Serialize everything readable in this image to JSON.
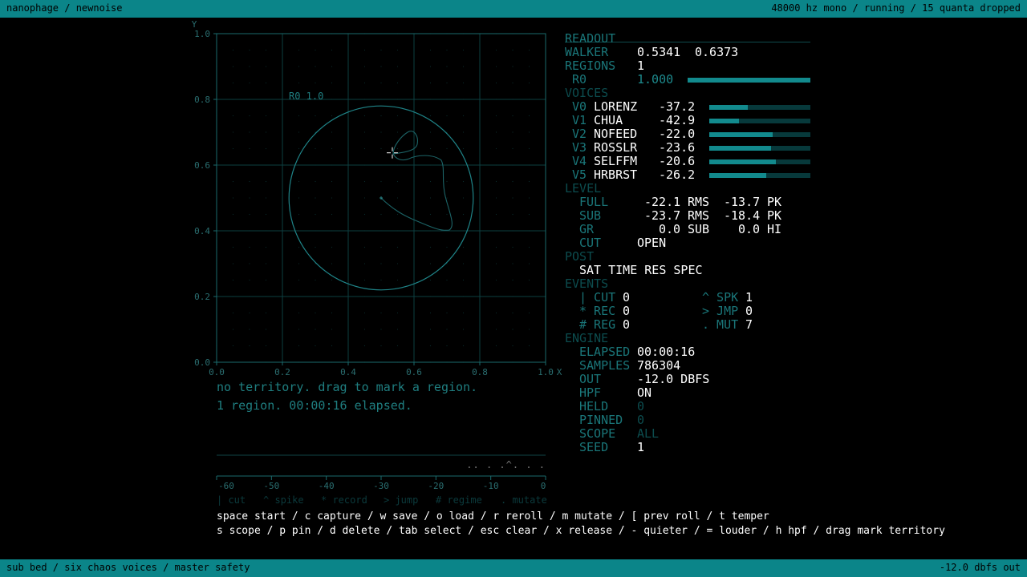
{
  "topbar": {
    "left": "nanophage / newnoise",
    "right": "48000 hz mono / running / 15 quanta dropped"
  },
  "bottombar": {
    "left": "sub bed / six chaos voices / master safety",
    "right": "-12.0 dbfs out"
  },
  "plot": {
    "x_ticks": [
      "0.0",
      "0.2",
      "0.4",
      "0.6",
      "0.8",
      "1.0"
    ],
    "y_ticks": [
      "0.0",
      "0.2",
      "0.4",
      "0.6",
      "0.8",
      "1.0"
    ],
    "x_label": "X",
    "y_label": "Y",
    "region_label": "R0 1.0",
    "region": {
      "cx": 0.5,
      "cy": 0.5,
      "r": 0.28
    },
    "walker": {
      "x": 0.5341,
      "y": 0.6373
    },
    "seed_point": {
      "x": 0.5,
      "y": 0.5
    }
  },
  "status": {
    "line1": "no territory. drag to mark a region.",
    "line2": "1 region. 00:00:16 elapsed."
  },
  "scope": {
    "event_marks": ".. .   .^. . .",
    "ticks": [
      "-60",
      "-50",
      "-40",
      "-30",
      "-20",
      "-10",
      "0"
    ],
    "legend": [
      "| cut",
      "^ spike",
      "* record",
      "> jump",
      "# regime",
      ". mutate"
    ]
  },
  "readout": {
    "title": "READOUT",
    "walker_label": "WALKER",
    "walker_x": "0.5341",
    "walker_y": "0.6373",
    "regions_label": "REGIONS",
    "regions_value": "1",
    "r0_label": "R0",
    "r0_value": "1.000",
    "r0_level": 1.0,
    "voices_label": "VOICES",
    "voices": [
      {
        "id": "V0",
        "name": "LORENZ",
        "db": "-37.2",
        "level": 0.38
      },
      {
        "id": "V1",
        "name": "CHUA",
        "db": "-42.9",
        "level": 0.29
      },
      {
        "id": "V2",
        "name": "NOFEED",
        "db": "-22.0",
        "level": 0.63
      },
      {
        "id": "V3",
        "name": "ROSSLR",
        "db": "-23.6",
        "level": 0.61
      },
      {
        "id": "V4",
        "name": "SELFFM",
        "db": "-20.6",
        "level": 0.66
      },
      {
        "id": "V5",
        "name": "HRBRST",
        "db": "-26.2",
        "level": 0.56
      }
    ],
    "level_label": "LEVEL",
    "full_label": "FULL",
    "full_rms": "-22.1",
    "full_pk": "-13.7",
    "sub_label": "SUB",
    "sub_rms": "-23.7",
    "sub_pk": "-18.4",
    "rms_unit": "RMS",
    "pk_unit": "PK",
    "gr_label": "GR",
    "gr_sub": "0.0",
    "gr_sub_unit": "SUB",
    "gr_hi": "0.0",
    "gr_hi_unit": "HI",
    "cut_label": "CUT",
    "cut_value": "OPEN",
    "post_label": "POST",
    "post_value": "SAT TIME RES SPEC",
    "events_label": "EVENTS",
    "events": [
      {
        "label": "| CUT",
        "value": "0",
        "label2": "^ SPK",
        "value2": "1"
      },
      {
        "label": "* REC",
        "value": "0",
        "label2": "> JMP",
        "value2": "0"
      },
      {
        "label": "# REG",
        "value": "0",
        "label2": ". MUT",
        "value2": "7"
      }
    ],
    "engine_label": "ENGINE",
    "elapsed_label": "ELAPSED",
    "elapsed": "00:00:16",
    "samples_label": "SAMPLES",
    "samples": "786304",
    "out_label": "OUT",
    "out": "-12.0 DBFS",
    "hpf_label": "HPF",
    "hpf": "ON",
    "held_label": "HELD",
    "held": "0",
    "pinned_label": "PINNED",
    "pinned": "0",
    "scope_label": "SCOPE",
    "scope": "ALL",
    "seed_label": "SEED",
    "seed": "1"
  },
  "help": {
    "line1": "space start  /  c capture  /  w save  /  o load  /  r reroll  /  m mutate  /  [ prev roll  /  t temper",
    "line2": "s scope  /  p pin  /  d delete  /  tab select  /  esc clear  /  x release  /  - quieter  /  = louder  /  h hpf  /  drag  mark territory"
  },
  "colors": {
    "accent": "#0b8589",
    "grid": "#0d3f41",
    "trace": "#1d6f72",
    "text": "#e8e8e8"
  }
}
